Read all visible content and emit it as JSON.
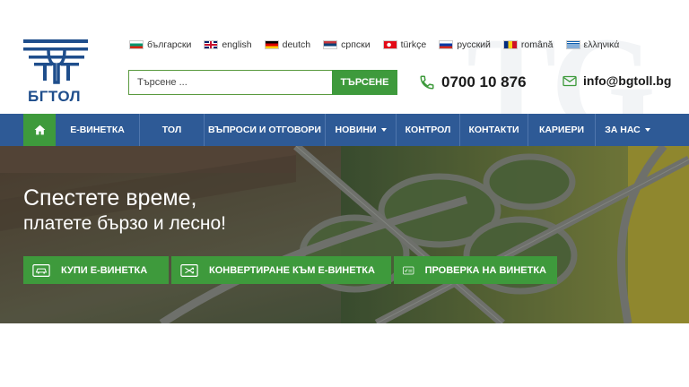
{
  "logo": {
    "text": "БГТОЛ"
  },
  "languages": [
    {
      "label": "български",
      "flag": "bg"
    },
    {
      "label": "english",
      "flag": "gb"
    },
    {
      "label": "deutch",
      "flag": "de"
    },
    {
      "label": "српски",
      "flag": "rs"
    },
    {
      "label": "türkçe",
      "flag": "tr"
    },
    {
      "label": "русский",
      "flag": "ru"
    },
    {
      "label": "română",
      "flag": "ro"
    },
    {
      "label": "ελληνικά",
      "flag": "gr"
    }
  ],
  "search": {
    "placeholder": "Търсене ...",
    "button_label": "ТЪРСЕНЕ"
  },
  "contact": {
    "phone": "0700 10 876",
    "email": "info@bgtoll.bg"
  },
  "nav": [
    {
      "label": "Е-ВИНЕТКА"
    },
    {
      "label": "ТОЛ"
    },
    {
      "label": "ВЪПРОСИ И ОТГОВОРИ"
    },
    {
      "label": "НОВИНИ",
      "dropdown": true
    },
    {
      "label": "КОНТРОЛ"
    },
    {
      "label": "КОНТАКТИ"
    },
    {
      "label": "КАРИЕРИ"
    },
    {
      "label": "ЗА НАС",
      "dropdown": true
    }
  ],
  "hero": {
    "headline_1": "Спестете време,",
    "headline_2": "платете бързо и лесно!",
    "buttons": [
      {
        "label": "КУПИ Е-ВИНЕТКА"
      },
      {
        "label": "КОНВЕРТИРАНЕ КЪМ Е-ВИНЕТКА"
      },
      {
        "label": "ПРОВЕРКА НА ВИНЕТКА"
      }
    ]
  },
  "colors": {
    "brand_blue": "#2e5a96",
    "brand_green": "#3e9a3c"
  }
}
